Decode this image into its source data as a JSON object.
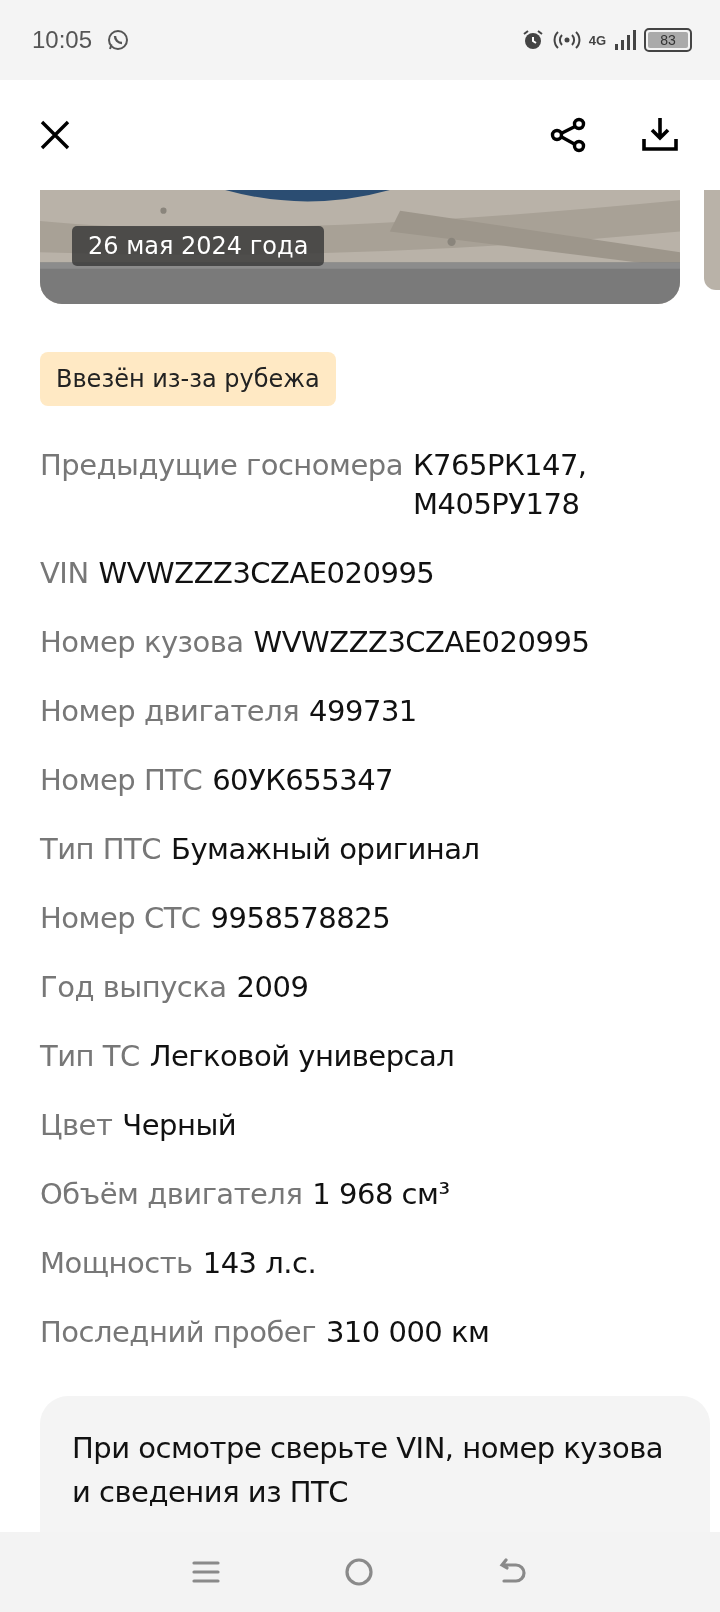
{
  "status_bar": {
    "time": "10:05",
    "network": "4G",
    "battery": "83"
  },
  "photo": {
    "date": "26 мая 2024 года"
  },
  "tag": "Ввезён из-за рубежа",
  "details": [
    {
      "label": "Предыдущие госномера",
      "value": "К765РК147, М405РУ178"
    },
    {
      "label": "VIN",
      "value": "WVWZZZ3CZAE020995"
    },
    {
      "label": "Номер кузова",
      "value": "WVWZZZ3CZAE020995"
    },
    {
      "label": "Номер двигателя",
      "value": "499731"
    },
    {
      "label": "Номер ПТС",
      "value": "60УК655347"
    },
    {
      "label": "Тип ПТС",
      "value": "Бумажный оригинал"
    },
    {
      "label": "Номер СТС",
      "value": "9958578825"
    },
    {
      "label": "Год выпуска",
      "value": "2009"
    },
    {
      "label": "Тип ТС",
      "value": "Легковой универсал"
    },
    {
      "label": "Цвет",
      "value": "Черный"
    },
    {
      "label": "Объём двигателя",
      "value": "1 968 см³"
    },
    {
      "label": "Мощность",
      "value": "143 л.с."
    },
    {
      "label": "Последний пробег",
      "value": "310 000 км"
    }
  ],
  "notice": "При осмотре сверьте VIN, номер кузова и сведения из ПТС"
}
